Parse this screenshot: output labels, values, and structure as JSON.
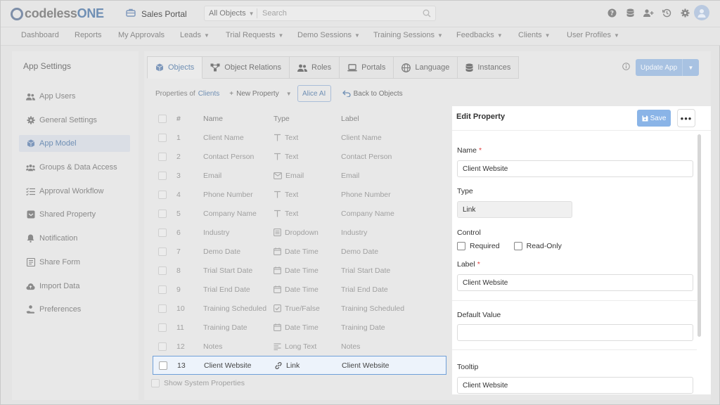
{
  "header": {
    "logo_prefix": "codeless",
    "logo_suffix": "ONE",
    "app_name": "Sales Portal",
    "object_select": "All Objects",
    "search_placeholder": "Search"
  },
  "nav": [
    "Dashboard",
    "Reports",
    "My Approvals",
    "Leads",
    "Trial Requests",
    "Demo Sessions",
    "Training Sessions",
    "Feedbacks",
    "Clients",
    "User Profiles"
  ],
  "sidebar": {
    "title": "App Settings",
    "items": [
      {
        "label": "App Users",
        "icon": "users-icon"
      },
      {
        "label": "General Settings",
        "icon": "gear-icon"
      },
      {
        "label": "App Model",
        "icon": "cube-icon"
      },
      {
        "label": "Groups & Data Access",
        "icon": "group-icon"
      },
      {
        "label": "Approval Workflow",
        "icon": "checklist-icon"
      },
      {
        "label": "Shared Property",
        "icon": "inbox-icon"
      },
      {
        "label": "Notification",
        "icon": "bell-icon"
      },
      {
        "label": "Share Form",
        "icon": "form-icon"
      },
      {
        "label": "Import Data",
        "icon": "cloud-upload-icon"
      },
      {
        "label": "Preferences",
        "icon": "user-hand-icon"
      }
    ],
    "active_index": 2
  },
  "tabs": [
    {
      "label": "Objects",
      "icon": "cube-icon"
    },
    {
      "label": "Object Relations",
      "icon": "relations-icon"
    },
    {
      "label": "Roles",
      "icon": "users-icon"
    },
    {
      "label": "Portals",
      "icon": "laptop-icon"
    },
    {
      "label": "Language",
      "icon": "globe-icon"
    },
    {
      "label": "Instances",
      "icon": "database-icon"
    }
  ],
  "active_tab": 0,
  "update_app_label": "Update App",
  "toolbar": {
    "properties_of": "Properties of",
    "object_name": "Clients",
    "new_property": "New Property",
    "alice_ai": "Alice AI",
    "back_to_objects": "Back to Objects"
  },
  "table": {
    "headers": {
      "num": "#",
      "name": "Name",
      "type": "Type",
      "label": "Label"
    },
    "rows": [
      {
        "num": "1",
        "name": "Client Name",
        "type": "Text",
        "label": "Client Name",
        "icon": "text-icon"
      },
      {
        "num": "2",
        "name": "Contact Person",
        "type": "Text",
        "label": "Contact Person",
        "icon": "text-icon"
      },
      {
        "num": "3",
        "name": "Email",
        "type": "Email",
        "label": "Email",
        "icon": "email-icon"
      },
      {
        "num": "4",
        "name": "Phone Number",
        "type": "Text",
        "label": "Phone Number",
        "icon": "text-icon"
      },
      {
        "num": "5",
        "name": "Company Name",
        "type": "Text",
        "label": "Company Name",
        "icon": "text-icon"
      },
      {
        "num": "6",
        "name": "Industry",
        "type": "Dropdown",
        "label": "Industry",
        "icon": "dropdown-icon"
      },
      {
        "num": "7",
        "name": "Demo Date",
        "type": "Date Time",
        "label": "Demo Date",
        "icon": "calendar-icon"
      },
      {
        "num": "8",
        "name": "Trial Start Date",
        "type": "Date Time",
        "label": "Trial Start Date",
        "icon": "calendar-icon"
      },
      {
        "num": "9",
        "name": "Trial End Date",
        "type": "Date Time",
        "label": "Trial End Date",
        "icon": "calendar-icon"
      },
      {
        "num": "10",
        "name": "Training Scheduled",
        "type": "True/False",
        "label": "Training Scheduled",
        "icon": "checkbox-icon"
      },
      {
        "num": "11",
        "name": "Training Date",
        "type": "Date Time",
        "label": "Training Date",
        "icon": "calendar-icon"
      },
      {
        "num": "12",
        "name": "Notes",
        "type": "Long Text",
        "label": "Notes",
        "icon": "long-text-icon"
      },
      {
        "num": "13",
        "name": "Client Website",
        "type": "Link",
        "label": "Client Website",
        "icon": "link-icon"
      }
    ],
    "selected_index": 12,
    "show_system": "Show System Properties"
  },
  "edit": {
    "title": "Edit Property",
    "save": "Save",
    "more": "•••",
    "name_label": "Name",
    "name_value": "Client Website",
    "type_label": "Type",
    "type_value": "Link",
    "control_label": "Control",
    "required": "Required",
    "read_only": "Read-Only",
    "label_label": "Label",
    "label_value": "Client Website",
    "default_label": "Default Value",
    "default_value": "",
    "tooltip_label": "Tooltip",
    "tooltip_value": "Client Website",
    "required_mark": "*"
  },
  "colors": {
    "accent": "#6f8fb4",
    "save_button": "#8ab4e7",
    "selection_border": "#6f9fd8"
  }
}
